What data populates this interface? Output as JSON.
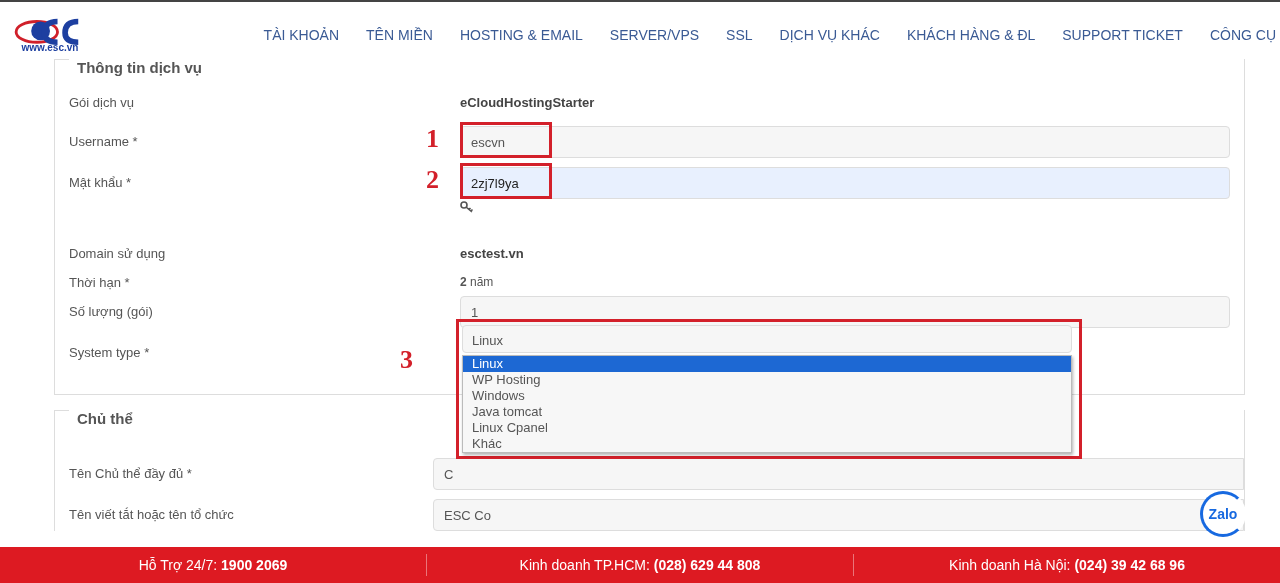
{
  "header": {
    "logo_text": "www.esc.vn",
    "nav": [
      "TÀI KHOẢN",
      "TÊN MIỀN",
      "HOSTING & EMAIL",
      "SERVER/VPS",
      "SSL",
      "DỊCH VỤ KHÁC",
      "KHÁCH HÀNG & ĐL",
      "SUPPORT TICKET",
      "CÔNG CỤ"
    ]
  },
  "sections": [
    {
      "title": "Thông tin dịch vụ",
      "rows": [
        {
          "kind": "static",
          "label": "Gói dịch vụ",
          "value": "eCloudHostingStarter"
        },
        {
          "kind": "input",
          "label": "Username *",
          "value": "escvn",
          "callout": "1"
        },
        {
          "kind": "password",
          "label": "Mật khẩu *",
          "value": "2zj7l9ya",
          "callout": "2"
        },
        {
          "kind": "static",
          "label": "Domain sử dụng",
          "value": "esctest.vn"
        },
        {
          "kind": "rich",
          "label": "Thời hạn *",
          "value": "**2** năm"
        },
        {
          "kind": "input",
          "label": "Số lượng (gói)",
          "value": "1"
        },
        {
          "kind": "select",
          "label": "System type *",
          "value": "Linux",
          "callout": "3",
          "options": [
            {
              "label": "Linux",
              "selected": true
            },
            {
              "label": "WP Hosting",
              "selected": false
            },
            {
              "label": "Windows",
              "selected": false
            },
            {
              "label": "Java tomcat",
              "selected": false
            },
            {
              "label": "Linux Cpanel",
              "selected": false
            },
            {
              "label": "Khác",
              "selected": false
            }
          ]
        }
      ]
    },
    {
      "title": "Chủ thể",
      "rows": [
        {
          "kind": "input",
          "label": "Tên Chủ thể đầy đủ *",
          "value": "C"
        },
        {
          "kind": "input",
          "label": "Tên viết tắt hoặc tên tổ chức",
          "value": "ESC Co"
        }
      ]
    }
  ],
  "chat_badge": "Zalo",
  "footer": [
    "Hỗ Trợ 24/7: **1900 2069**",
    "Kinh doanh TP.HCM: **(028) 629 44 808**",
    "Kinh doanh Hà Nội: **(024) 39 42 68 96**"
  ]
}
